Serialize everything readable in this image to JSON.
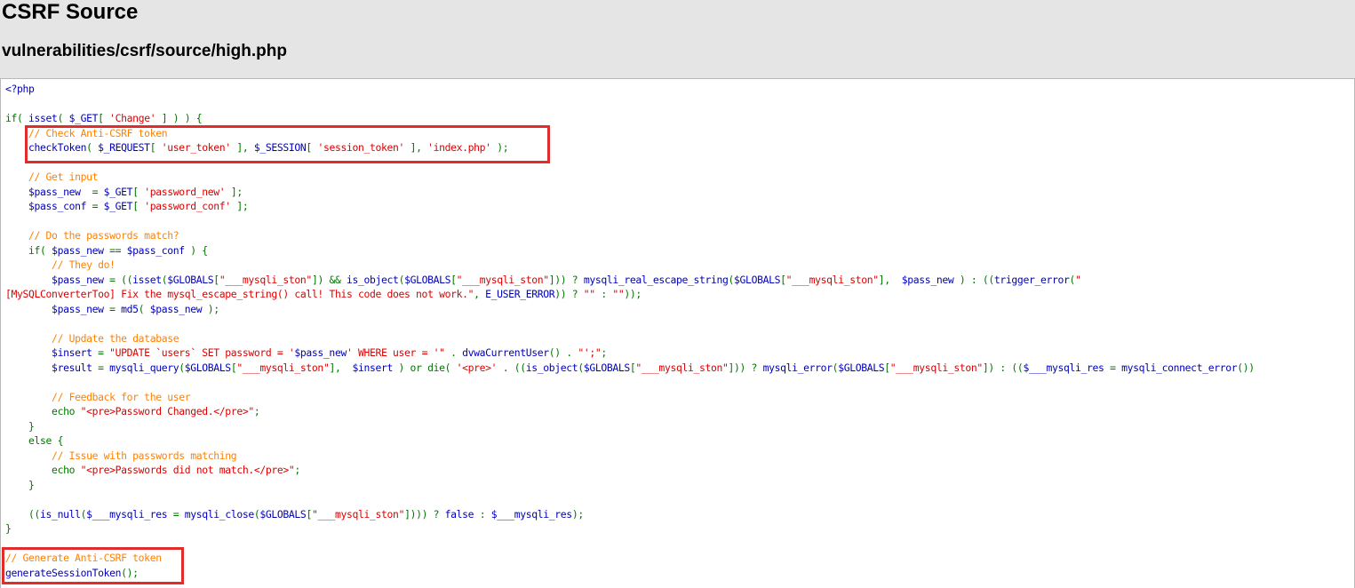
{
  "header": {
    "title": "CSRF Source",
    "subtitle": "vulnerabilities/csrf/source/high.php"
  },
  "colors": {
    "background": "#e5e5e5",
    "code_default": "#0000bb",
    "code_keyword": "#007700",
    "code_comment": "#ff8000",
    "code_string": "#dd0000",
    "highlight_box": "#e22b2b"
  },
  "code": {
    "lines": [
      [
        {
          "t": "<?php",
          "c": "d"
        }
      ],
      [],
      [
        {
          "t": "if( ",
          "c": "k"
        },
        {
          "t": "isset",
          "c": "d"
        },
        {
          "t": "( ",
          "c": "k"
        },
        {
          "t": "$_GET",
          "c": "d"
        },
        {
          "t": "[ ",
          "c": "k"
        },
        {
          "t": "'Change'",
          "c": "s"
        },
        {
          "t": " ] ) ) {",
          "c": "k"
        }
      ],
      [
        {
          "t": "    // Check Anti-CSRF token",
          "c": "c"
        }
      ],
      [
        {
          "t": "    checkToken",
          "c": "d"
        },
        {
          "t": "( ",
          "c": "k"
        },
        {
          "t": "$_REQUEST",
          "c": "d"
        },
        {
          "t": "[ ",
          "c": "k"
        },
        {
          "t": "'user_token'",
          "c": "s"
        },
        {
          "t": " ], ",
          "c": "k"
        },
        {
          "t": "$_SESSION",
          "c": "d"
        },
        {
          "t": "[ ",
          "c": "k"
        },
        {
          "t": "'session_token'",
          "c": "s"
        },
        {
          "t": " ], ",
          "c": "k"
        },
        {
          "t": "'index.php'",
          "c": "s"
        },
        {
          "t": " );",
          "c": "k"
        }
      ],
      [],
      [
        {
          "t": "    // Get input",
          "c": "c"
        }
      ],
      [
        {
          "t": "    $pass_new  ",
          "c": "d"
        },
        {
          "t": "= ",
          "c": "k"
        },
        {
          "t": "$_GET",
          "c": "d"
        },
        {
          "t": "[ ",
          "c": "k"
        },
        {
          "t": "'password_new'",
          "c": "s"
        },
        {
          "t": " ];",
          "c": "k"
        }
      ],
      [
        {
          "t": "    $pass_conf ",
          "c": "d"
        },
        {
          "t": "= ",
          "c": "k"
        },
        {
          "t": "$_GET",
          "c": "d"
        },
        {
          "t": "[ ",
          "c": "k"
        },
        {
          "t": "'password_conf'",
          "c": "s"
        },
        {
          "t": " ];",
          "c": "k"
        }
      ],
      [],
      [
        {
          "t": "    // Do the passwords match?",
          "c": "c"
        }
      ],
      [
        {
          "t": "    if( ",
          "c": "k"
        },
        {
          "t": "$pass_new ",
          "c": "d"
        },
        {
          "t": "== ",
          "c": "k"
        },
        {
          "t": "$pass_conf ",
          "c": "d"
        },
        {
          "t": ") {",
          "c": "k"
        }
      ],
      [
        {
          "t": "        // They do!",
          "c": "c"
        }
      ],
      [
        {
          "t": "        $pass_new ",
          "c": "d"
        },
        {
          "t": "= ((",
          "c": "k"
        },
        {
          "t": "isset",
          "c": "d"
        },
        {
          "t": "(",
          "c": "k"
        },
        {
          "t": "$GLOBALS",
          "c": "d"
        },
        {
          "t": "[",
          "c": "k"
        },
        {
          "t": "\"___mysqli_ston\"",
          "c": "s"
        },
        {
          "t": "]) && ",
          "c": "k"
        },
        {
          "t": "is_object",
          "c": "d"
        },
        {
          "t": "(",
          "c": "k"
        },
        {
          "t": "$GLOBALS",
          "c": "d"
        },
        {
          "t": "[",
          "c": "k"
        },
        {
          "t": "\"___mysqli_ston\"",
          "c": "s"
        },
        {
          "t": "])) ? ",
          "c": "k"
        },
        {
          "t": "mysqli_real_escape_string",
          "c": "d"
        },
        {
          "t": "(",
          "c": "k"
        },
        {
          "t": "$GLOBALS",
          "c": "d"
        },
        {
          "t": "[",
          "c": "k"
        },
        {
          "t": "\"___mysqli_ston\"",
          "c": "s"
        },
        {
          "t": "],  ",
          "c": "k"
        },
        {
          "t": "$pass_new ",
          "c": "d"
        },
        {
          "t": ") : ((",
          "c": "k"
        },
        {
          "t": "trigger_error",
          "c": "d"
        },
        {
          "t": "(",
          "c": "k"
        },
        {
          "t": "\"",
          "c": "s"
        }
      ],
      [
        {
          "t": "[MySQLConverterToo] Fix the mysql_escape_string() call! This code does not work.\"",
          "c": "s"
        },
        {
          "t": ", ",
          "c": "k"
        },
        {
          "t": "E_USER_ERROR",
          "c": "d"
        },
        {
          "t": ")) ? ",
          "c": "k"
        },
        {
          "t": "\"\"",
          "c": "s"
        },
        {
          "t": " : ",
          "c": "k"
        },
        {
          "t": "\"\"",
          "c": "s"
        },
        {
          "t": "));",
          "c": "k"
        }
      ],
      [
        {
          "t": "        $pass_new ",
          "c": "d"
        },
        {
          "t": "= ",
          "c": "k"
        },
        {
          "t": "md5",
          "c": "d"
        },
        {
          "t": "( ",
          "c": "k"
        },
        {
          "t": "$pass_new ",
          "c": "d"
        },
        {
          "t": ");",
          "c": "k"
        }
      ],
      [],
      [
        {
          "t": "        // Update the database",
          "c": "c"
        }
      ],
      [
        {
          "t": "        $insert ",
          "c": "d"
        },
        {
          "t": "= ",
          "c": "k"
        },
        {
          "t": "\"UPDATE `users` SET password = '",
          "c": "s"
        },
        {
          "t": "$pass_new",
          "c": "d"
        },
        {
          "t": "' WHERE user = '\"",
          "c": "s"
        },
        {
          "t": " . ",
          "c": "k"
        },
        {
          "t": "dvwaCurrentUser",
          "c": "d"
        },
        {
          "t": "() . ",
          "c": "k"
        },
        {
          "t": "\"';\"",
          "c": "s"
        },
        {
          "t": ";",
          "c": "k"
        }
      ],
      [
        {
          "t": "        $result ",
          "c": "d"
        },
        {
          "t": "= ",
          "c": "k"
        },
        {
          "t": "mysqli_query",
          "c": "d"
        },
        {
          "t": "(",
          "c": "k"
        },
        {
          "t": "$GLOBALS",
          "c": "d"
        },
        {
          "t": "[",
          "c": "k"
        },
        {
          "t": "\"___mysqli_ston\"",
          "c": "s"
        },
        {
          "t": "],  ",
          "c": "k"
        },
        {
          "t": "$insert ",
          "c": "d"
        },
        {
          "t": ") or die( ",
          "c": "k"
        },
        {
          "t": "'<pre>'",
          "c": "s"
        },
        {
          "t": " . ((",
          "c": "k"
        },
        {
          "t": "is_object",
          "c": "d"
        },
        {
          "t": "(",
          "c": "k"
        },
        {
          "t": "$GLOBALS",
          "c": "d"
        },
        {
          "t": "[",
          "c": "k"
        },
        {
          "t": "\"___mysqli_ston\"",
          "c": "s"
        },
        {
          "t": "])) ? ",
          "c": "k"
        },
        {
          "t": "mysqli_error",
          "c": "d"
        },
        {
          "t": "(",
          "c": "k"
        },
        {
          "t": "$GLOBALS",
          "c": "d"
        },
        {
          "t": "[",
          "c": "k"
        },
        {
          "t": "\"___mysqli_ston\"",
          "c": "s"
        },
        {
          "t": "]) : ((",
          "c": "k"
        },
        {
          "t": "$___mysqli_res ",
          "c": "d"
        },
        {
          "t": "= ",
          "c": "k"
        },
        {
          "t": "mysqli_connect_error",
          "c": "d"
        },
        {
          "t": "())",
          "c": "k"
        }
      ],
      [],
      [
        {
          "t": "        // Feedback for the user",
          "c": "c"
        }
      ],
      [
        {
          "t": "        echo ",
          "c": "k"
        },
        {
          "t": "\"<pre>Password Changed.</pre>\"",
          "c": "s"
        },
        {
          "t": ";",
          "c": "k"
        }
      ],
      [
        {
          "t": "    }",
          "c": "k"
        }
      ],
      [
        {
          "t": "    else {",
          "c": "k"
        }
      ],
      [
        {
          "t": "        // Issue with passwords matching",
          "c": "c"
        }
      ],
      [
        {
          "t": "        echo ",
          "c": "k"
        },
        {
          "t": "\"<pre>Passwords did not match.</pre>\"",
          "c": "s"
        },
        {
          "t": ";",
          "c": "k"
        }
      ],
      [
        {
          "t": "    }",
          "c": "k"
        }
      ],
      [],
      [
        {
          "t": "    ((",
          "c": "k"
        },
        {
          "t": "is_null",
          "c": "d"
        },
        {
          "t": "(",
          "c": "k"
        },
        {
          "t": "$___mysqli_res ",
          "c": "d"
        },
        {
          "t": "= ",
          "c": "k"
        },
        {
          "t": "mysqli_close",
          "c": "d"
        },
        {
          "t": "(",
          "c": "k"
        },
        {
          "t": "$GLOBALS",
          "c": "d"
        },
        {
          "t": "[",
          "c": "k"
        },
        {
          "t": "\"___mysqli_ston\"",
          "c": "s"
        },
        {
          "t": "]))) ? ",
          "c": "k"
        },
        {
          "t": "false ",
          "c": "d"
        },
        {
          "t": ": ",
          "c": "k"
        },
        {
          "t": "$___mysqli_res",
          "c": "d"
        },
        {
          "t": ");",
          "c": "k"
        }
      ],
      [
        {
          "t": "}",
          "c": "k"
        }
      ],
      [],
      [
        {
          "t": "// Generate Anti-CSRF token",
          "c": "c"
        }
      ],
      [
        {
          "t": "generateSessionToken",
          "c": "d"
        },
        {
          "t": "();",
          "c": "k"
        }
      ]
    ]
  }
}
